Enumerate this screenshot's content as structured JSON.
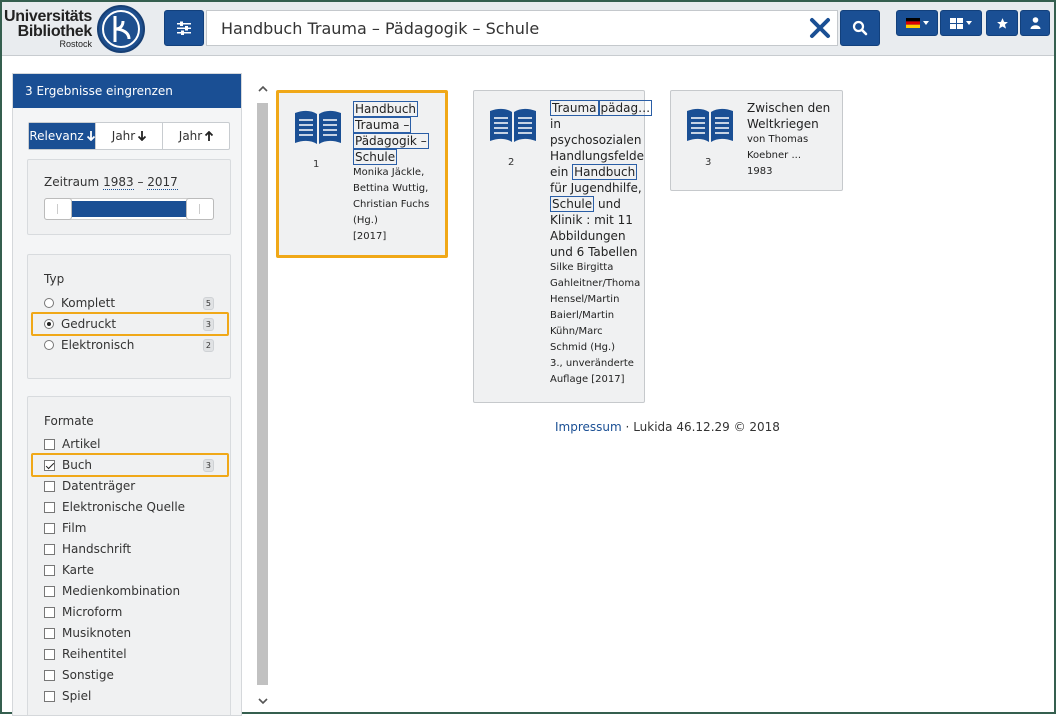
{
  "header": {
    "logo_line1": "Universitäts",
    "logo_line2": "Bibliothek",
    "logo_line3": "Rostock",
    "search_value": "Handbuch Trauma – Pädagogik – Schule",
    "language": "de"
  },
  "sidebar": {
    "heading": "3 Ergebnisse eingrenzen",
    "sort": [
      "Relevanz",
      "Jahr",
      "Jahr"
    ],
    "range_label": "Zeitraum",
    "range_from": "1983",
    "range_to": "2017",
    "range_sep": "–",
    "typ_title": "Typ",
    "typ": [
      {
        "label": "Komplett",
        "count": "5",
        "selected": false
      },
      {
        "label": "Gedruckt",
        "count": "3",
        "selected": true
      },
      {
        "label": "Elektronisch",
        "count": "2",
        "selected": false
      }
    ],
    "formate_title": "Formate",
    "formate": [
      {
        "label": "Artikel",
        "checked": false
      },
      {
        "label": "Buch",
        "count": "3",
        "checked": true
      },
      {
        "label": "Datenträger",
        "checked": false
      },
      {
        "label": "Elektronische Quelle",
        "checked": false
      },
      {
        "label": "Film",
        "checked": false
      },
      {
        "label": "Handschrift",
        "checked": false
      },
      {
        "label": "Karte",
        "checked": false
      },
      {
        "label": "Medienkombination",
        "checked": false
      },
      {
        "label": "Microform",
        "checked": false
      },
      {
        "label": "Musiknoten",
        "checked": false
      },
      {
        "label": "Reihentitel",
        "checked": false
      },
      {
        "label": "Sonstige",
        "checked": false
      },
      {
        "label": "Spiel",
        "checked": false
      }
    ]
  },
  "results": [
    {
      "num": "1",
      "title_parts": [
        "Handbuch",
        "Trauma –",
        "Pädagogik –",
        "Schule"
      ],
      "authors": [
        "Monika Jäckle,",
        "Bettina Wuttig,",
        "Christian Fuchs",
        "(Hg.)"
      ],
      "year": "[2017]"
    },
    {
      "num": "2",
      "title_hl1": "Trauma",
      "title_hl2": "pädag…",
      "title_l2": "in",
      "title_l3": "psychosozialen",
      "title_l4": "Handlungsfelde",
      "title_l5a": "ein",
      "title_hl3": "Handbuch",
      "title_l6": "für Jugendhilfe,",
      "title_hl4": "Schule",
      "title_l7": "und",
      "title_l8": "Klinik : mit 11",
      "title_l9": "Abbildungen",
      "title_l10": "und 6 Tabellen",
      "authors": [
        "Silke Birgitta",
        "Gahleitner/Thoma",
        "Hensel/Martin",
        "Baierl/Martin",
        "Kühn/Marc",
        "Schmid (Hg.)"
      ],
      "edition": [
        "3., unveränderte",
        "Auflage [2017]"
      ]
    },
    {
      "num": "3",
      "title_lines": [
        "Zwischen den",
        "Weltkriegen"
      ],
      "authors": [
        "von Thomas",
        "Koebner ..."
      ],
      "year": "1983"
    }
  ],
  "footer": {
    "impressum": "Impressum",
    "sep": "·",
    "version": "Lukida 46.12.29 © 2018"
  },
  "colors": {
    "primary": "#1a4f94",
    "highlight": "#f0a818"
  }
}
